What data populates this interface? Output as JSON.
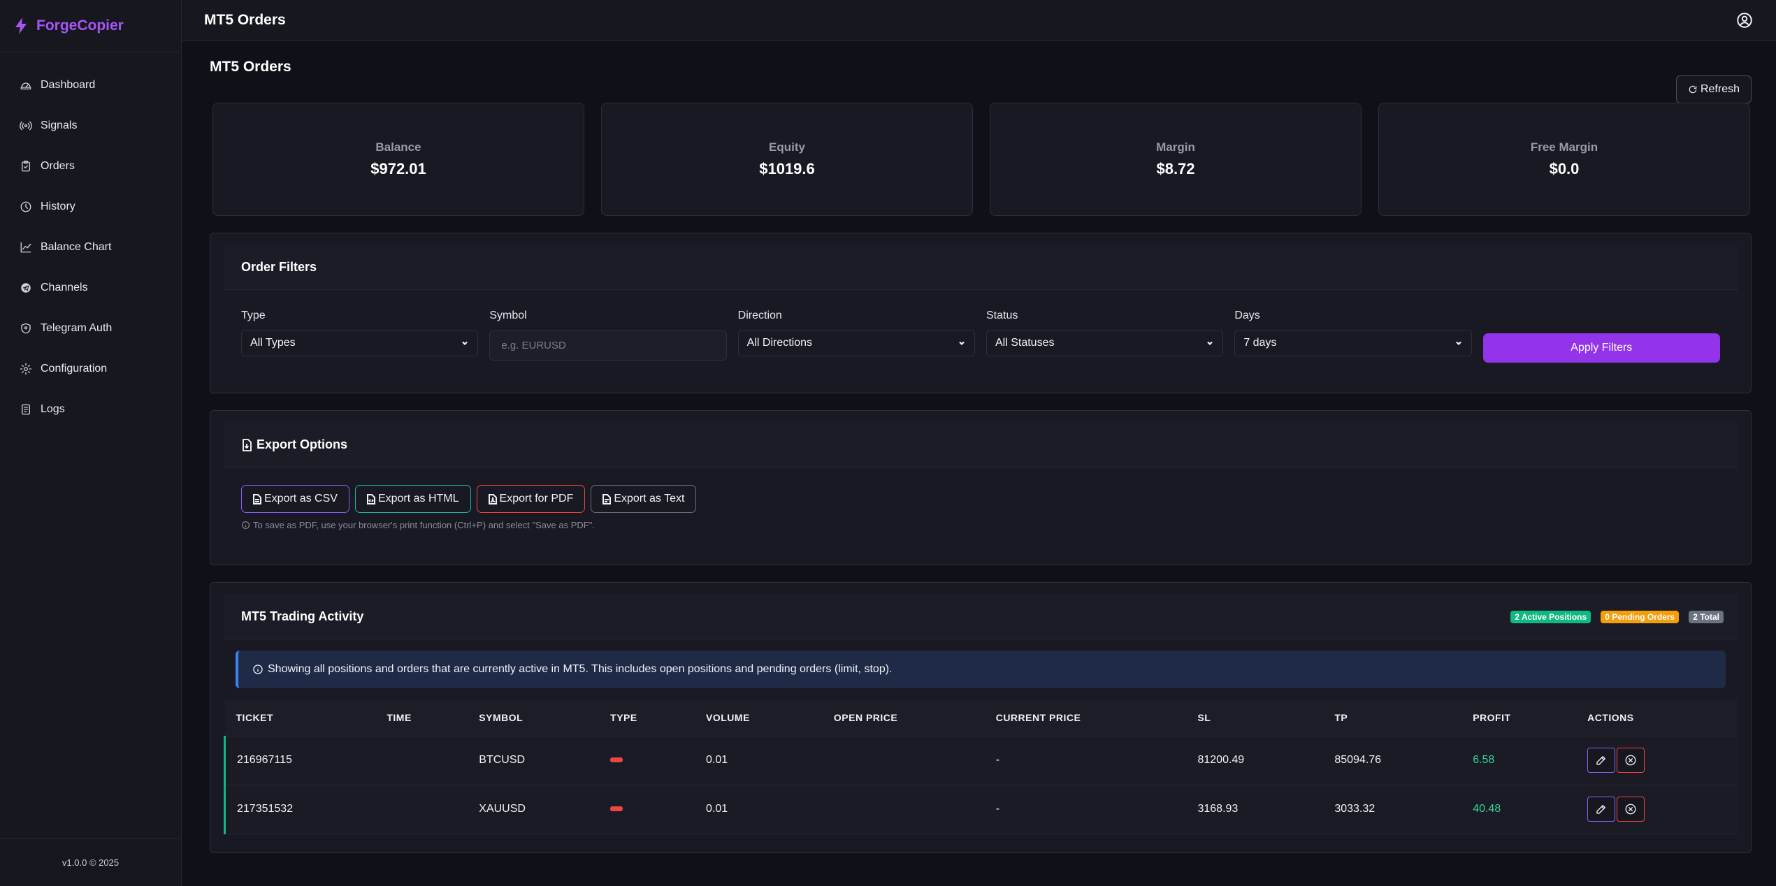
{
  "app": {
    "name": "ForgeCopier",
    "version": "v1.0.0 © 2025",
    "brand_color": "#a855f7"
  },
  "sidebar": {
    "items": [
      {
        "label": "Dashboard",
        "icon": "gauge-icon"
      },
      {
        "label": "Signals",
        "icon": "broadcast-icon"
      },
      {
        "label": "Orders",
        "icon": "clipboard-icon"
      },
      {
        "label": "History",
        "icon": "clock-icon"
      },
      {
        "label": "Balance Chart",
        "icon": "line-chart-icon"
      },
      {
        "label": "Channels",
        "icon": "telegram-icon"
      },
      {
        "label": "Telegram Auth",
        "icon": "shield-icon"
      },
      {
        "label": "Configuration",
        "icon": "gear-icon"
      },
      {
        "label": "Logs",
        "icon": "document-icon"
      }
    ]
  },
  "topbar": {
    "title": "MT5 Orders"
  },
  "page": {
    "title": "MT5 Orders",
    "refresh_label": "Refresh"
  },
  "stats": {
    "balance": {
      "label": "Balance",
      "value": "$972.01"
    },
    "equity": {
      "label": "Equity",
      "value": "$1019.6"
    },
    "margin": {
      "label": "Margin",
      "value": "$8.72"
    },
    "free_margin": {
      "label": "Free Margin",
      "value": "$0.0"
    }
  },
  "filters": {
    "title": "Order Filters",
    "type": {
      "label": "Type",
      "value": "All Types"
    },
    "symbol": {
      "label": "Symbol",
      "placeholder": "e.g. EURUSD"
    },
    "direction": {
      "label": "Direction",
      "value": "All Directions"
    },
    "status": {
      "label": "Status",
      "value": "All Statuses"
    },
    "days": {
      "label": "Days",
      "value": "7 days"
    },
    "apply_label": "Apply Filters"
  },
  "export": {
    "title": "Export Options",
    "csv": "Export as CSV",
    "html": "Export as HTML",
    "pdf": "Export for PDF",
    "text": "Export as Text",
    "note": "To save as PDF, use your browser's print function (Ctrl+P) and select \"Save as PDF\"."
  },
  "activity": {
    "title": "MT5 Trading Activity",
    "badges": {
      "active": "2 Active Positions",
      "pending": "0 Pending Orders",
      "total": "2 Total"
    },
    "info": "Showing all positions and orders that are currently active in MT5. This includes open positions and pending orders (limit, stop).",
    "columns": [
      "TICKET",
      "TIME",
      "SYMBOL",
      "TYPE",
      "VOLUME",
      "OPEN PRICE",
      "CURRENT PRICE",
      "SL",
      "TP",
      "PROFIT",
      "ACTIONS"
    ],
    "rows": [
      {
        "ticket": "216967115",
        "time": "",
        "symbol": "BTCUSD",
        "volume": "0.01",
        "open_price": "",
        "current_price": "-",
        "sl": "81200.49",
        "tp": "85094.76",
        "profit": "6.58"
      },
      {
        "ticket": "217351532",
        "time": "",
        "symbol": "XAUUSD",
        "volume": "0.01",
        "open_price": "",
        "current_price": "-",
        "sl": "3168.93",
        "tp": "3033.32",
        "profit": "40.48"
      }
    ]
  }
}
